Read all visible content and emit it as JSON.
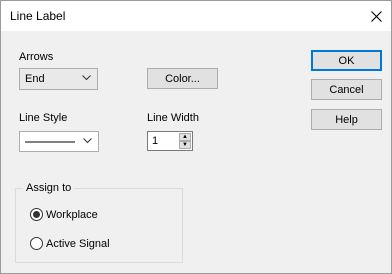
{
  "window": {
    "title": "Line Label"
  },
  "arrows": {
    "label": "Arrows",
    "selected": "End"
  },
  "buttons": {
    "color": "Color...",
    "ok": "OK",
    "cancel": "Cancel",
    "help": "Help"
  },
  "line_style": {
    "label": "Line Style"
  },
  "line_width": {
    "label": "Line Width",
    "value": "1"
  },
  "assign_to": {
    "caption": "Assign to",
    "options": [
      {
        "label": "Workplace",
        "selected": true
      },
      {
        "label": "Active Signal",
        "selected": false
      }
    ]
  }
}
